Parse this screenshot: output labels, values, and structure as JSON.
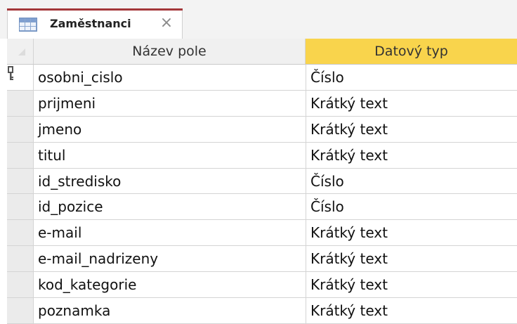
{
  "tab": {
    "title": "Zaměstnanci",
    "close_glyph": "×",
    "icon": "table-icon"
  },
  "grid": {
    "headers": {
      "field_name": "Název pole",
      "data_type": "Datový typ"
    },
    "header_highlight_color": "#f9d44c",
    "rows": [
      {
        "field": "osobni_cislo",
        "type": "Číslo",
        "primary_key": true
      },
      {
        "field": "prijmeni",
        "type": "Krátký text"
      },
      {
        "field": "jmeno",
        "type": "Krátký text"
      },
      {
        "field": "titul",
        "type": "Krátký text"
      },
      {
        "field": "id_stredisko",
        "type": "Číslo"
      },
      {
        "field": "id_pozice",
        "type": "Číslo"
      },
      {
        "field": "e-mail",
        "type": "Krátký text"
      },
      {
        "field": "e-mail_nadrizeny",
        "type": "Krátký text"
      },
      {
        "field": "kod_kategorie",
        "type": "Krátký text"
      },
      {
        "field": "poznamka",
        "type": "Krátký text"
      }
    ]
  },
  "colors": {
    "tab_accent": "#a4373a"
  }
}
